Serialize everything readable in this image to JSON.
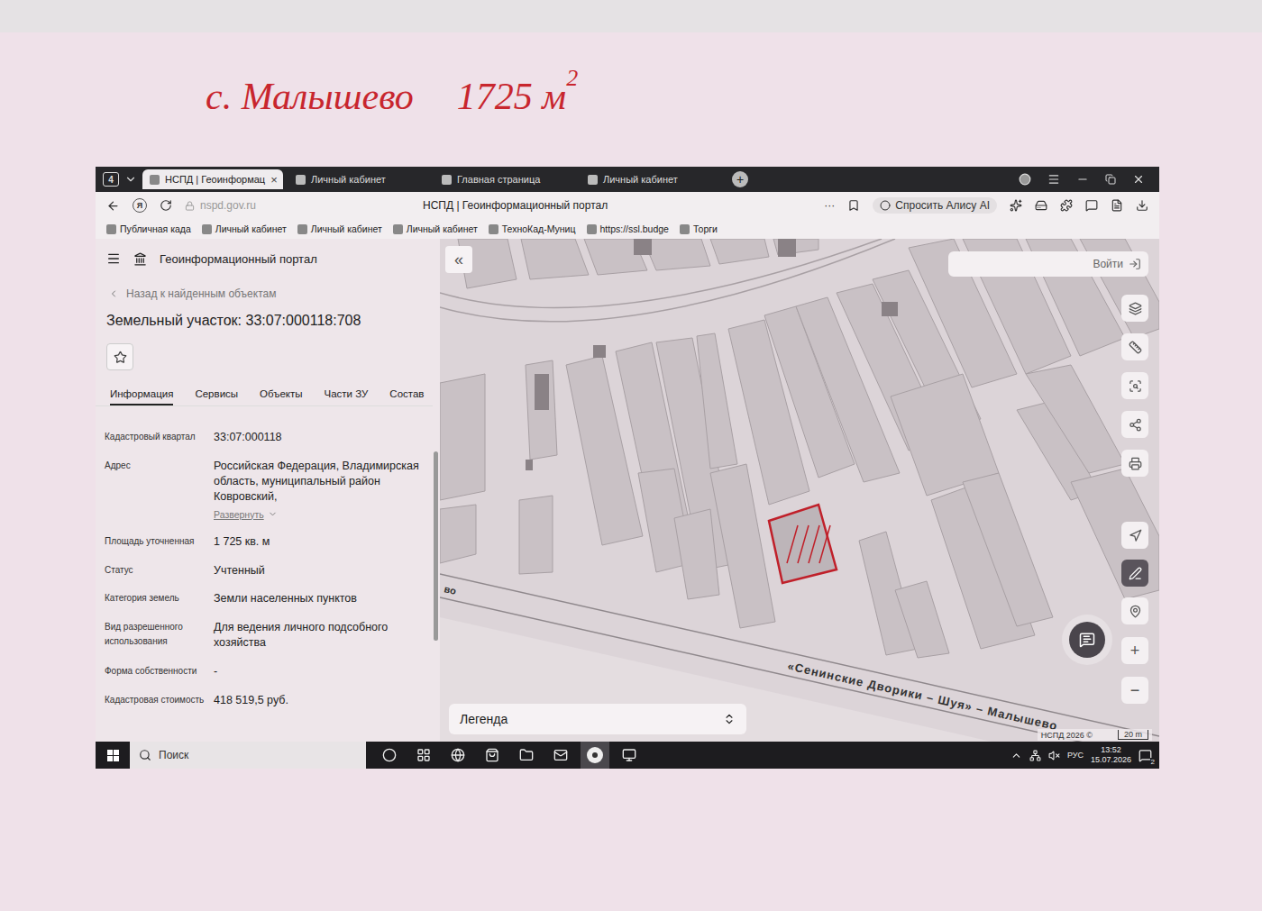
{
  "note": {
    "place": "с. Малышево",
    "area": "1725 м",
    "area_power": "2"
  },
  "browser": {
    "tab_count": "4",
    "tabs": [
      {
        "label": "НСПД | Геоинформац",
        "selected": true
      },
      {
        "label": "Личный кабинет",
        "selected": false
      },
      {
        "label": "Главная страница",
        "selected": false
      },
      {
        "label": "Личный кабинет",
        "selected": false
      }
    ],
    "tab_close": "×",
    "new_tab": "+",
    "url": "nspd.gov.ru",
    "search_engine": "Я",
    "page_title": "НСПД | Геоинформационный портал",
    "more": "···",
    "assistant": "Спросить Алису AI",
    "bookmarks": [
      "Публичная када",
      "Личный кабинет",
      "Личный кабинет",
      "Личный кабинет",
      "ТехноКад-Муниц",
      "https://ssl.budge",
      "Торги"
    ]
  },
  "panel": {
    "app_title": "Геоинформационный портал",
    "back": "Назад к найденным объектам",
    "title": "Земельный участок: 33:07:000118:708",
    "favorite": false,
    "tabs": [
      {
        "label": "Информация",
        "selected": true
      },
      {
        "label": "Сервисы",
        "selected": false
      },
      {
        "label": "Объекты",
        "selected": false
      },
      {
        "label": "Части ЗУ",
        "selected": false
      },
      {
        "label": "Состав",
        "selected": false
      }
    ],
    "tabs_more": "›",
    "fields": [
      {
        "label": "Кадастровый квартал",
        "value": "33:07:000118"
      },
      {
        "label": "Адрес",
        "value": "Российская Федерация, Владимирская область, муниципальный район Ковровский,",
        "expand": "Развернуть"
      },
      {
        "label": "Площадь уточненная",
        "value": "1 725 кв. м"
      },
      {
        "label": "Статус",
        "value": "Учтенный"
      },
      {
        "label": "Категория земель",
        "value": "Земли населенных пунктов"
      },
      {
        "label": "Вид разрешенного использования",
        "value": "Для ведения личного подсобного хозяйства"
      },
      {
        "label": "Форма собственности",
        "value": "-"
      },
      {
        "label": "Кадастровая стоимость",
        "value": "418 519,5 руб."
      }
    ],
    "scroll": {
      "level": 0.6
    }
  },
  "map": {
    "collapse": "«",
    "login": "Войти",
    "road_label": "«Сенинские Дворики – Шуя» – Малышево",
    "road_label_cut": "во",
    "parcel": {
      "selected": true
    },
    "tools": [
      {
        "kind": "layers",
        "active": false
      },
      {
        "kind": "ruler",
        "active": false
      },
      {
        "kind": "select",
        "active": false
      },
      {
        "kind": "share",
        "active": false
      },
      {
        "kind": "print",
        "active": false
      }
    ],
    "nav_tools": [
      {
        "kind": "locate",
        "active": false
      },
      {
        "kind": "draw",
        "active": true
      },
      {
        "kind": "marker",
        "active": false
      }
    ],
    "zoom": [
      "+",
      "−"
    ],
    "legend": "Легенда",
    "copyright": "НСПД 2026 ©",
    "scale": "20 m"
  },
  "taskbar": {
    "search": "Поиск",
    "apps": [
      {
        "kind": "cortana",
        "active": false
      },
      {
        "kind": "taskview",
        "active": false
      },
      {
        "kind": "edge",
        "active": false
      },
      {
        "kind": "store",
        "active": false
      },
      {
        "kind": "explorer",
        "active": false
      },
      {
        "kind": "mail",
        "active": false
      },
      {
        "kind": "yandex",
        "active": true
      },
      {
        "kind": "manager",
        "active": false
      }
    ],
    "language": "РУС",
    "time": "13:52",
    "date": "15.07.2026",
    "notifications": "2"
  }
}
